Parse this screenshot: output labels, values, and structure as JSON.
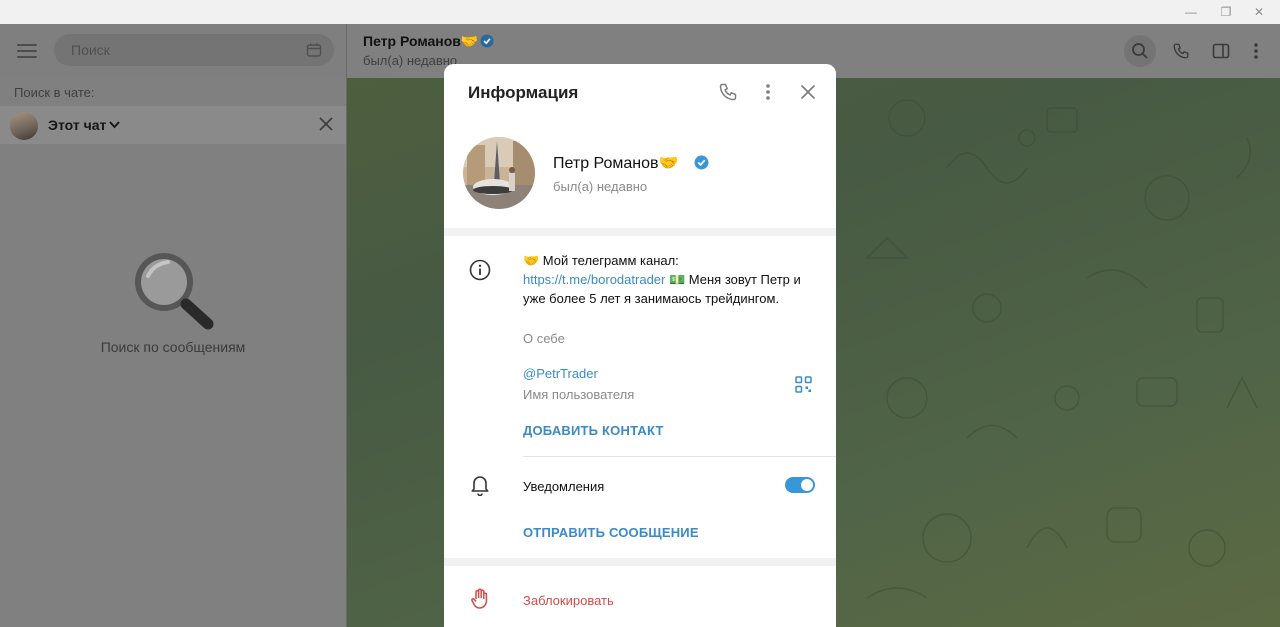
{
  "window": {
    "minimize": "—",
    "restore": "❐",
    "close": "✕"
  },
  "left_panel": {
    "search_placeholder": "Поиск",
    "search_in_chat_label": "Поиск в чате:",
    "chat_selector": "Этот чат",
    "empty_text": "Поиск по сообщениям"
  },
  "chat_header": {
    "name": "Петр Романов🤝",
    "status": "был(а) недавно"
  },
  "info": {
    "title": "Информация",
    "profile": {
      "name": "Петр Романов🤝",
      "status": "был(а) недавно",
      "verified": true
    },
    "bio": {
      "line_prefix": "🤝 Мой телеграмм канал:",
      "link": "https://t.me/borodatrader",
      "line_suffix": "💵 Меня зовут Петр и уже более 5 лет я занимаюсь трейдингом.",
      "label": "О себе"
    },
    "username": {
      "value": "@PetrTrader",
      "label": "Имя пользователя"
    },
    "add_contact": "ДОБАВИТЬ КОНТАКТ",
    "notifications": {
      "label": "Уведомления",
      "enabled": true
    },
    "send_message": "ОТПРАВИТЬ СООБЩЕНИЕ",
    "block": "Заблокировать"
  },
  "colors": {
    "accent": "#3a8ac5",
    "danger": "#d54a4a",
    "toggle": "#3a97d7",
    "verified": "#3a97d7"
  },
  "icons": [
    "menu-icon",
    "calendar-icon",
    "chevron-down-icon",
    "close-icon",
    "magnifier-icon",
    "search-icon",
    "phone-icon",
    "sidebar-icon",
    "more-icon",
    "info-icon",
    "qr-code-icon",
    "bell-icon",
    "hand-stop-icon",
    "verified-icon"
  ]
}
